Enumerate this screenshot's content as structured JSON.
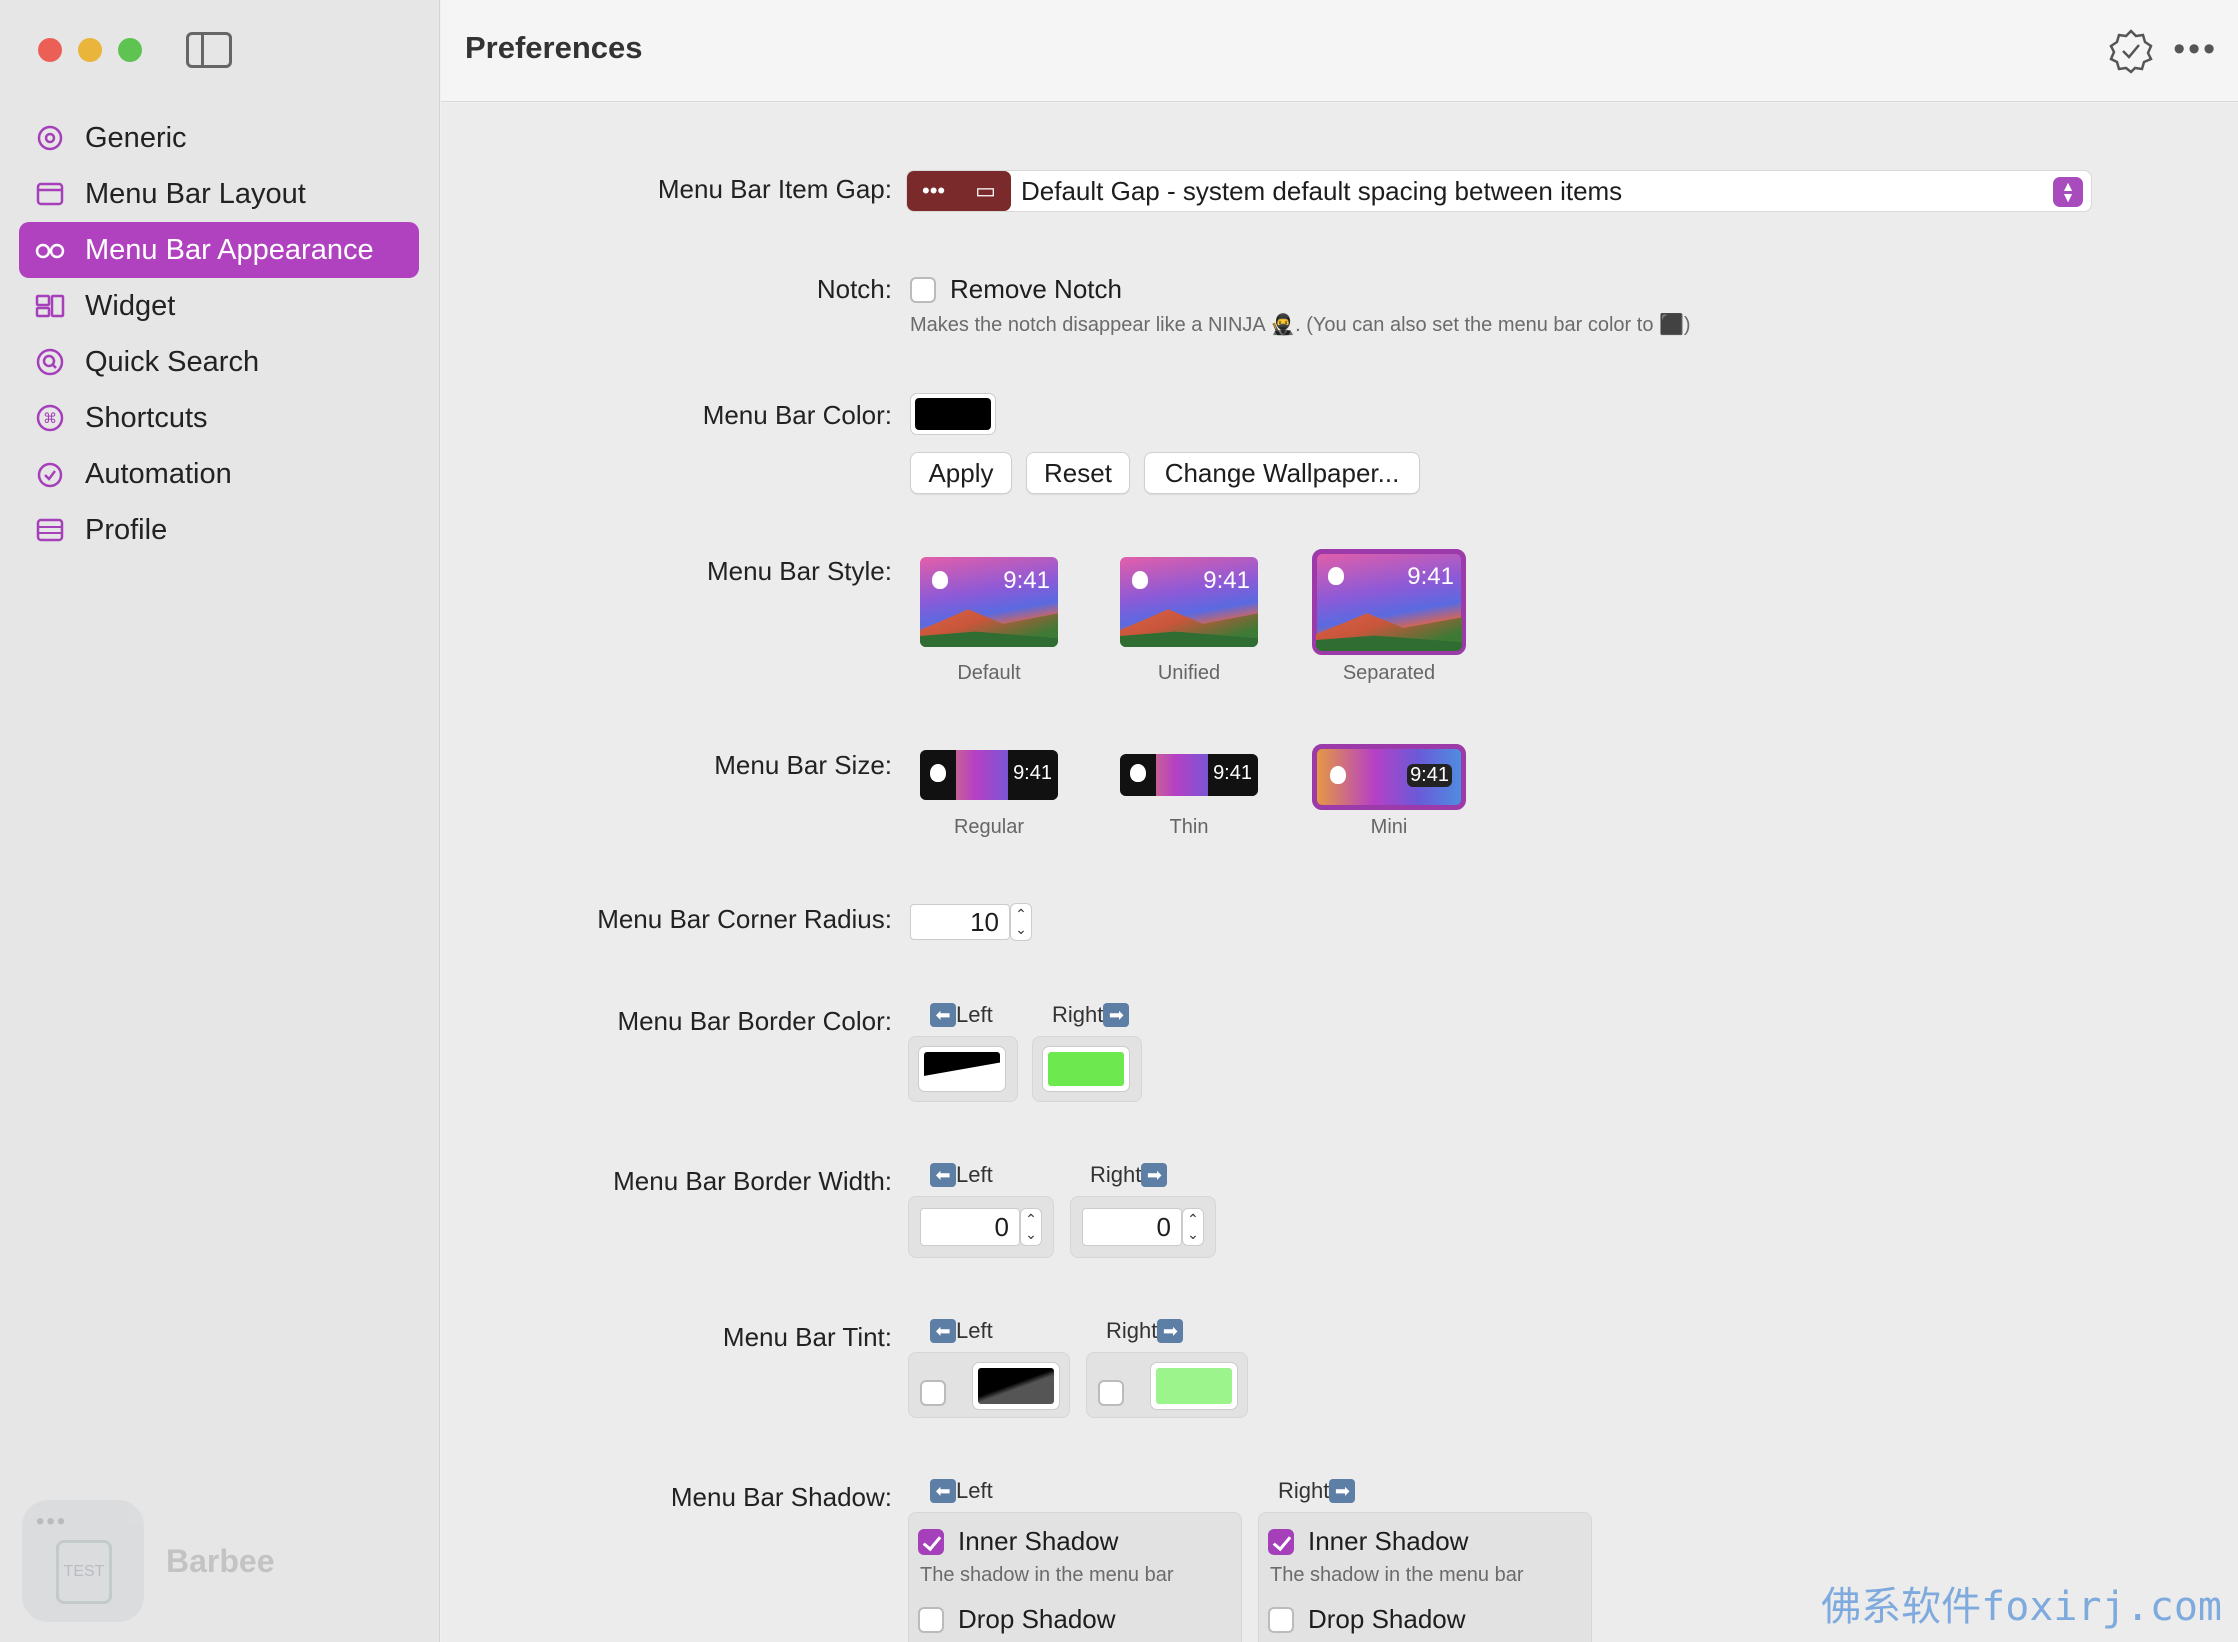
{
  "sidebar": {
    "items": [
      {
        "label": "Generic",
        "icon": "gear-icon"
      },
      {
        "label": "Menu Bar Layout",
        "icon": "window-icon"
      },
      {
        "label": "Menu Bar Appearance",
        "icon": "glasses-icon"
      },
      {
        "label": "Widget",
        "icon": "widget-icon"
      },
      {
        "label": "Quick Search",
        "icon": "magnifier-icon"
      },
      {
        "label": "Shortcuts",
        "icon": "command-icon"
      },
      {
        "label": "Automation",
        "icon": "clock-check-icon"
      },
      {
        "label": "Profile",
        "icon": "storage-icon"
      }
    ],
    "active_index": 2,
    "brand": {
      "name": "Barbee",
      "badge": "TEST",
      "dots": "•••"
    }
  },
  "header": {
    "title": "Preferences",
    "more": "•••"
  },
  "colors": {
    "accent": "#b042c0",
    "gap_icon": "#7a2a2a",
    "border_right": "#6ee84f",
    "tint_right": "#9cf58c"
  },
  "settings": {
    "item_gap": {
      "label": "Menu Bar Item Gap:",
      "value": "Default Gap - system default spacing between items",
      "icon_dots": "•••"
    },
    "notch": {
      "label": "Notch:",
      "checkbox_label": "Remove Notch",
      "checked": false,
      "hint": "Makes the notch disappear like a NINJA 🥷. (You can also set the menu bar color to ⬛)"
    },
    "menu_bar_color": {
      "label": "Menu Bar Color:",
      "value": "#000000",
      "buttons": [
        "Apply",
        "Reset",
        "Change Wallpaper..."
      ]
    },
    "style": {
      "label": "Menu Bar Style:",
      "time": "9:41",
      "options": [
        "Default",
        "Unified",
        "Separated"
      ],
      "selected": "Separated"
    },
    "size": {
      "label": "Menu Bar Size:",
      "time": "9:41",
      "options": [
        "Regular",
        "Thin",
        "Mini"
      ],
      "selected": "Mini"
    },
    "corner_radius": {
      "label": "Menu Bar Corner Radius:",
      "value": "10"
    },
    "border_color": {
      "label": "Menu Bar Border Color:",
      "left_label": "Left",
      "right_label": "Right",
      "left_value": "#000000",
      "right_value": "#6ee84f"
    },
    "border_width": {
      "label": "Menu Bar Border Width:",
      "left_label": "Left",
      "right_label": "Right",
      "left_value": "0",
      "right_value": "0"
    },
    "tint": {
      "label": "Menu Bar Tint:",
      "left_label": "Left",
      "right_label": "Right",
      "left_checked": false,
      "right_checked": false
    },
    "shadow": {
      "label": "Menu Bar Shadow:",
      "left_label": "Left",
      "right_label": "Right",
      "inner_label": "Inner Shadow",
      "inner_hint": "The shadow in the menu bar",
      "drop_label": "Drop Shadow",
      "left_inner": true,
      "left_drop": false,
      "right_inner": true,
      "right_drop": false
    }
  },
  "watermark": "佛系软件foxirj.com"
}
